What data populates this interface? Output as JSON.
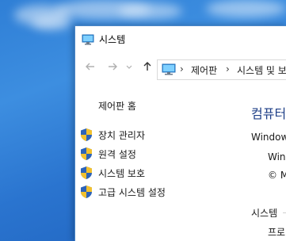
{
  "window": {
    "title": "시스템"
  },
  "navigation": {
    "back_icon": "back-arrow-icon",
    "forward_icon": "forward-arrow-icon",
    "recent_icon": "chevron-down-icon",
    "up_icon": "up-arrow-icon",
    "breadcrumb": [
      "제어판",
      "시스템 및 보"
    ],
    "separator": "›"
  },
  "sidebar": {
    "home_link": "제어판 홈",
    "tasks": [
      {
        "label": "장치 관리자",
        "icon": "uac-shield-icon"
      },
      {
        "label": "원격 설정",
        "icon": "uac-shield-icon"
      },
      {
        "label": "시스템 보호",
        "icon": "uac-shield-icon"
      },
      {
        "label": "고급 시스템 설정",
        "icon": "uac-shield-icon"
      }
    ]
  },
  "main": {
    "heading": "컴퓨터",
    "windows_section": "Window",
    "edition_line": "Windo",
    "copyright_line": "© M",
    "system_section": "시스템",
    "processor_line": "프로"
  },
  "colors": {
    "heading": "#1e3f87",
    "desktop": "#2f7fd6",
    "shield_blue": "#2d63b8",
    "shield_yellow": "#f2c12e"
  }
}
